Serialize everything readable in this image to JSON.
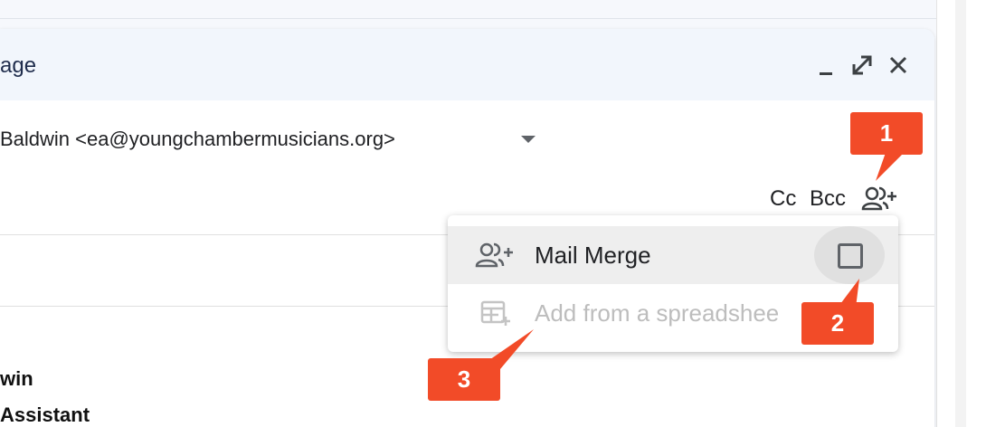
{
  "compose": {
    "title": "age",
    "from": "Baldwin <ea@youngchambermusicians.org>",
    "cc_label": "Cc",
    "bcc_label": "Bcc",
    "signature_line1": "win",
    "signature_line2": "Assistant"
  },
  "header_icons": [
    "minimize-icon",
    "expand-icon",
    "close-icon"
  ],
  "menu": {
    "items": [
      {
        "label": "Mail Merge",
        "icon": "mail-merge-icon",
        "checkbox_checked": false,
        "disabled": false
      },
      {
        "label": "Add from a spreadshee",
        "icon": "spreadsheet-add-icon",
        "disabled": true
      }
    ]
  },
  "callouts": [
    "1",
    "2",
    "3"
  ],
  "colors": {
    "callout": "#f24b28",
    "header_bg": "#f2f6fc",
    "title": "#1f2c4c",
    "disabled_text": "#bdbdbd"
  }
}
